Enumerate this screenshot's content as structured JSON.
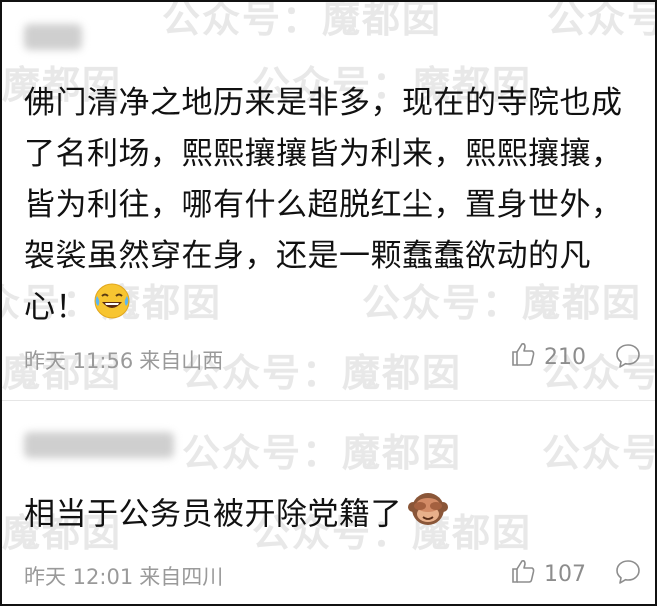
{
  "watermark": "公众号：魔都囡",
  "comments": [
    {
      "text": "佛门清净之地历来是非多，现在的寺院也成了名利场，熙熙攘攘皆为利来，熙熙攘攘，皆为利往，哪有什么超脱红尘，置身世外，袈裟虽然穿在身，还是一颗蠢蠢欲动的凡心！",
      "emoji": "laughing-tears",
      "time": "昨天 11:56",
      "location": "来自山西",
      "likes": "210"
    },
    {
      "text": "相当于公务员被开除党籍了",
      "emoji": "monkey",
      "time": "昨天 12:01",
      "location": "来自四川",
      "likes": "107"
    }
  ],
  "colors": {
    "meta": "#9a9a9a",
    "text": "#111111",
    "watermark": "#e8e8e8"
  }
}
